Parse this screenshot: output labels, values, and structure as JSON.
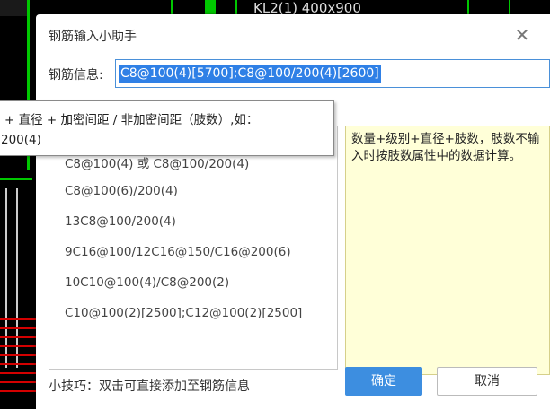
{
  "background": {
    "cad_label": "KL2(1) 400x900"
  },
  "dialog": {
    "title": "钢筋输入小助手",
    "close_icon": "close-icon",
    "info_label": "钢筋信息:",
    "info_value": "C8@100(4)[5700];C8@100/200(4)[2600]",
    "examples": [
      "C8@100(4) 或 C8@100/200(4)",
      "C8@100(6)/200(4)",
      "13C8@100/200(4)",
      "9C16@100/12C16@150/C16@200(6)",
      "10C10@100(4)/C8@200(2)",
      "C10@100(2)[2500];C12@100(2)[2500]"
    ],
    "description": "数量+级别+直径+肢数，肢数不输入时按肢数属性中的数据计算。",
    "tip": "小技巧：双击可直接添加至钢筋信息",
    "ok_label": "确定",
    "cancel_label": "取消"
  },
  "tooltip": {
    "line1": "+ 直径 + 加密间距 / 非加密间距（肢数）,如：",
    "line2": "200(4)"
  },
  "colors": {
    "accent": "#2f80e6",
    "ok_button": "#3d8ee0",
    "description_bg": "#ffffd8",
    "cad_green": "#00c800"
  }
}
